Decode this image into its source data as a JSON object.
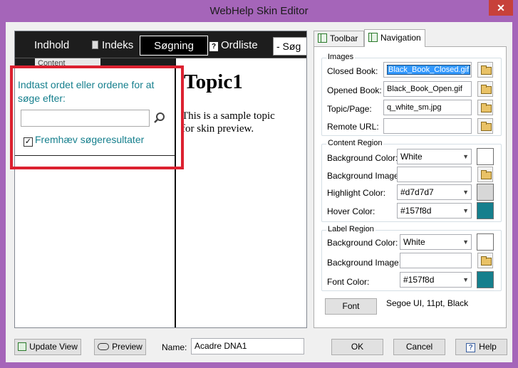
{
  "window": {
    "title": "WebHelp Skin Editor",
    "close_glyph": "✕"
  },
  "preview": {
    "tabs": {
      "indhold": "Indhold",
      "indeks": "Indeks",
      "sogning": "Søgning",
      "ordliste": "Ordliste"
    },
    "search_combo": "- Søg",
    "content_tab": "Content",
    "search_prompt": "Indtast ordet eller ordene for at søge efter:",
    "highlight_label": "Fremhæv søgeresultater",
    "topic_title": "Topic1",
    "topic_body": "This is a sample topic for skin preview."
  },
  "tabs": {
    "toolbar": "Toolbar",
    "navigation": "Navigation"
  },
  "images_group": {
    "title": "Images",
    "closed_book_label": "Closed Book:",
    "closed_book_value": "Black_Book_Closed.gif",
    "opened_book_label": "Opened Book:",
    "opened_book_value": "Black_Book_Open.gif",
    "topic_page_label": "Topic/Page:",
    "topic_page_value": "q_white_sm.jpg",
    "remote_url_label": "Remote URL:",
    "remote_url_value": ""
  },
  "content_region": {
    "title": "Content Region",
    "bg_color_label": "Background Color:",
    "bg_color_value": "White",
    "bg_image_label": "Background Image:",
    "bg_image_value": "",
    "highlight_label": "Highlight Color:",
    "highlight_value": "#d7d7d7",
    "hover_label": "Hover Color:",
    "hover_value": "#157f8d"
  },
  "label_region": {
    "title": "Label Region",
    "bg_color_label": "Background Color:",
    "bg_color_value": "White",
    "bg_image_label": "Background Image:",
    "bg_image_value": "",
    "font_color_label": "Font Color:",
    "font_color_value": "#157f8d"
  },
  "font": {
    "button_label": "Font",
    "description": "Segoe UI, 11pt, Black"
  },
  "bottom": {
    "update_view": "Update View",
    "preview": "Preview",
    "name_label": "Name:",
    "name_value": "Acadre DNA1",
    "ok": "OK",
    "cancel": "Cancel",
    "help": "Help"
  },
  "colors": {
    "white": "#ffffff",
    "highlight": "#d7d7d7",
    "hover": "#157f8d",
    "font": "#157f8d",
    "annotation_red": "#dc2130"
  }
}
